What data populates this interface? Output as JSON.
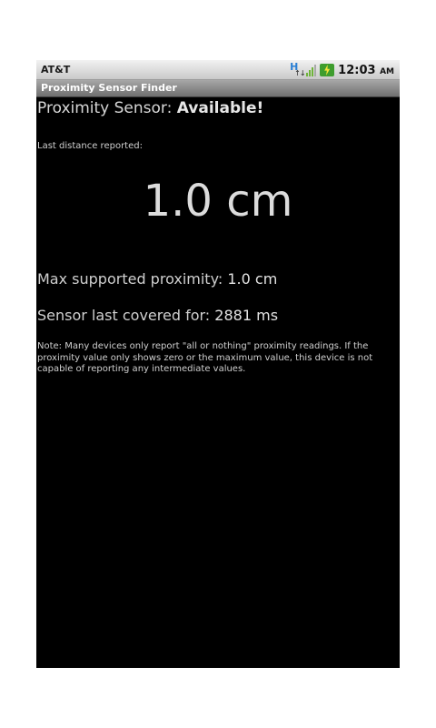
{
  "status_bar": {
    "carrier": "AT&T",
    "network_icon": "hsdpa-icon",
    "signal_icon": "signal-icon",
    "battery_icon": "battery-charging-icon",
    "time": "12:03",
    "ampm": "AM"
  },
  "app": {
    "title": "Proximity Sensor Finder"
  },
  "sensor": {
    "label": "Proximity Sensor:",
    "status": "Available!"
  },
  "last_distance": {
    "label": "Last distance reported:",
    "value": "1.0 cm"
  },
  "max_proximity": {
    "label": "Max supported proximity:",
    "value": "1.0 cm"
  },
  "last_covered": {
    "label": "Sensor last covered for:",
    "value": "2881 ms"
  },
  "note": "Note: Many devices only report \"all or nothing\" proximity readings. If the proximity value only shows zero or the maximum value, this device is not capable of reporting any intermediate values.",
  "colors": {
    "background": "#000000",
    "text": "#d6d6d6",
    "title_bar": "#8a8a8a"
  }
}
